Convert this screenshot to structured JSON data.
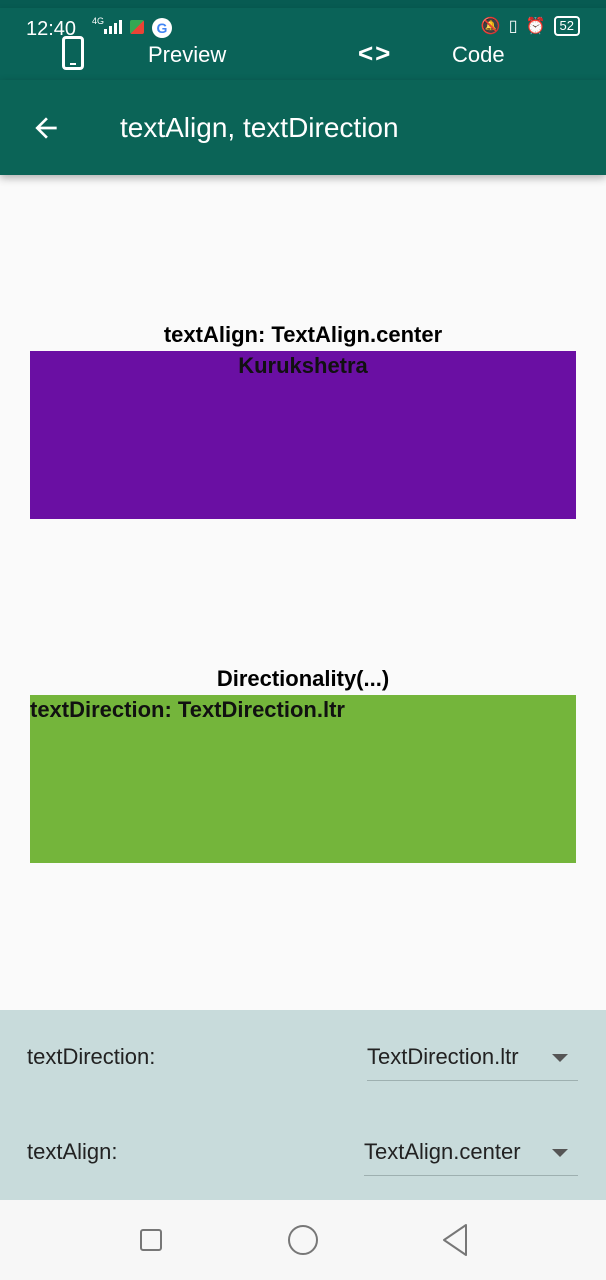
{
  "status_bar": {
    "time": "12:40",
    "network": "4G",
    "battery": "52"
  },
  "top_tabs": {
    "preview_label": "Preview",
    "code_label": "Code"
  },
  "app_bar": {
    "title": "textAlign, textDirection"
  },
  "demo1": {
    "label": "textAlign: TextAlign.center",
    "box_text": "Kurukshetra",
    "box_color": "#6a0fa3"
  },
  "demo2": {
    "label": "Directionality(...)",
    "box_text": "textDirection: TextDirection.ltr",
    "box_color": "#74b53b"
  },
  "controls": {
    "text_direction_label": "textDirection:",
    "text_direction_value": "TextDirection.ltr",
    "text_align_label": "textAlign:",
    "text_align_value": "TextAlign.center"
  },
  "colors": {
    "app_bar": "#0b6457",
    "controls_bg": "#c8dbdb"
  }
}
